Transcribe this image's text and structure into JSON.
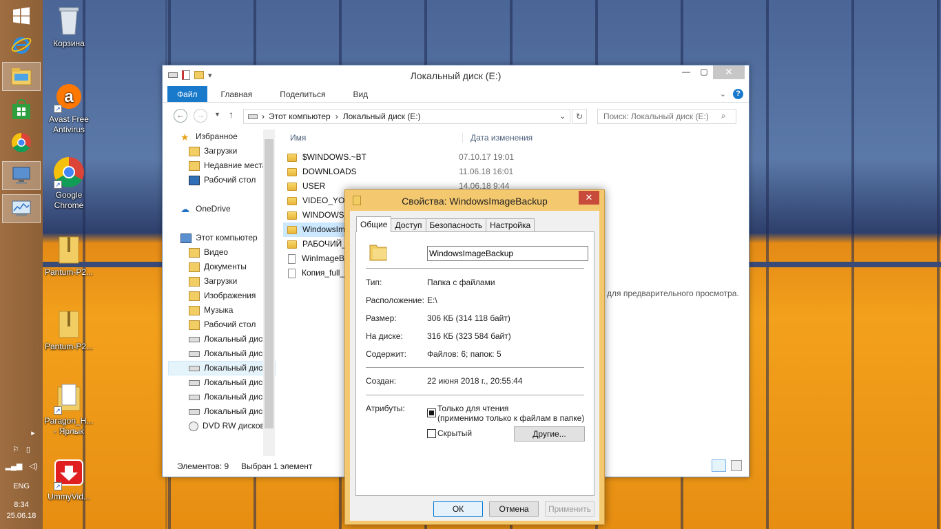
{
  "desktop": {
    "icons": [
      {
        "label": "Корзина"
      },
      {
        "label": "Avast Free Antivirus"
      },
      {
        "label": "Google Chrome"
      },
      {
        "label": "Pantum-P2..."
      },
      {
        "label": "Pantum-P2..."
      },
      {
        "label": "Paragon_H... - Ярлык"
      },
      {
        "label": "UmmyVid..."
      }
    ]
  },
  "taskbar": {
    "language": "ENG",
    "time": "8:34",
    "date": "25.06.18"
  },
  "explorer": {
    "title": "Локальный диск (E:)",
    "ribbon_tabs": [
      "Файл",
      "Главная",
      "Поделиться",
      "Вид"
    ],
    "address": {
      "root": "Этот компьютер",
      "current": "Локальный диск (E:)"
    },
    "search_placeholder": "Поиск: Локальный диск (E:)",
    "nav": {
      "favorites": "Избранное",
      "downloads": "Загрузки",
      "recent": "Недавние места",
      "desktop": "Рабочий стол",
      "onedrive": "OneDrive",
      "thispc": "Этот компьютер",
      "video": "Видео",
      "documents": "Документы",
      "downloads2": "Загрузки",
      "images": "Изображения",
      "music": "Музыка",
      "desktop2": "Рабочий стол",
      "disk1": "Локальный диск",
      "disk2": "Локальный диск",
      "disk3": "Локальный диск",
      "disk4": "Локальный диск",
      "disk5": "Локальный диск",
      "disk6": "Локальный диск",
      "dvd": "DVD RW дисково"
    },
    "columns": {
      "name": "Имя",
      "date": "Дата изменения"
    },
    "files": [
      {
        "name": "$WINDOWS.~BT",
        "date": "07.10.17 19:01",
        "type": "folder"
      },
      {
        "name": "DOWNLOADS",
        "date": "11.06.18 16:01",
        "type": "folder"
      },
      {
        "name": "USER",
        "date": "14.06.18 9:44",
        "type": "folder"
      },
      {
        "name": "VIDEO_YOU",
        "date": "",
        "type": "folder"
      },
      {
        "name": "WINDOWS_",
        "date": "",
        "type": "folder"
      },
      {
        "name": "WindowsIm",
        "date": "",
        "type": "folder"
      },
      {
        "name": "РАБОЧИЙ_",
        "date": "",
        "type": "folder"
      },
      {
        "name": "WinImageB",
        "date": "",
        "type": "file"
      },
      {
        "name": "Копия_full_",
        "date": "",
        "type": "file"
      }
    ],
    "preview_text": "для предварительного просмотра.",
    "status": {
      "count": "Элементов: 9",
      "selected": "Выбран 1 элемент"
    }
  },
  "properties": {
    "title": "Свойства: WindowsImageBackup",
    "tabs": [
      "Общие",
      "Доступ",
      "Безопасность",
      "Настройка"
    ],
    "name": "WindowsImageBackup",
    "type_label": "Тип:",
    "type_value": "Папка с файлами",
    "location_label": "Расположение:",
    "location_value": "E:\\",
    "size_label": "Размер:",
    "size_value": "306 КБ (314 118 байт)",
    "ondisk_label": "На диске:",
    "ondisk_value": "316 КБ (323 584 байт)",
    "contains_label": "Содержит:",
    "contains_value": "Файлов: 6; папок: 5",
    "created_label": "Создан:",
    "created_value": "22 июня 2018 г., 20:55:44",
    "attributes_label": "Атрибуты:",
    "readonly_label": "Только для чтения",
    "readonly_note": "(применимо только к файлам в папке)",
    "hidden_label": "Скрытый",
    "other_button": "Другие...",
    "ok": "ОК",
    "cancel": "Отмена",
    "apply": "Применить"
  }
}
